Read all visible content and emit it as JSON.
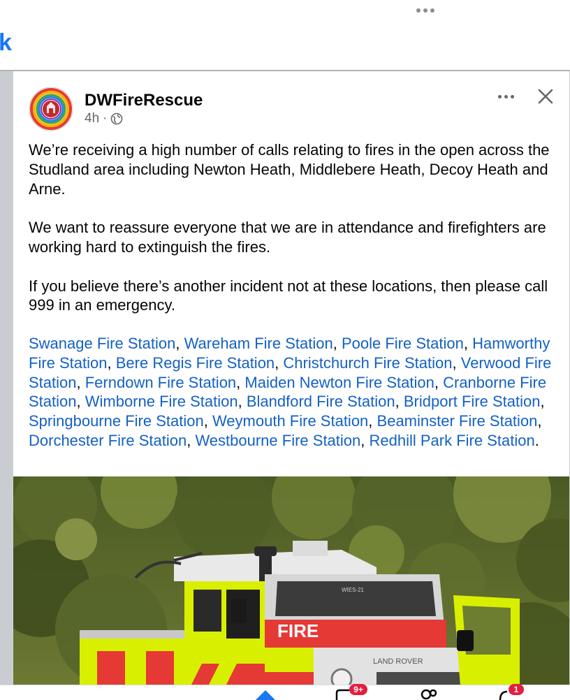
{
  "topbar": {
    "back_glyph": "k"
  },
  "post": {
    "author": "DWFireRescue",
    "time": "4h",
    "separator": "·",
    "paragraphs": [
      "We’re receiving a high number of calls relating to fires in the open across the Studland area including Newton Heath, Middlebere Heath, Decoy Heath and Arne.",
      "We want to reassure everyone that we are in attendance and firefighters are working hard to extinguish the fires.",
      "If you believe there’s another incident not at these locations, then please call 999 in an emergency."
    ],
    "tags": [
      "Swanage Fire Station",
      "Wareham Fire Station",
      "Poole Fire Station",
      "Hamworthy Fire Station",
      "Bere Regis Fire Station",
      "Christchurch Fire Station",
      "Verwood Fire Station",
      "Ferndown Fire Station",
      "Maiden Newton Fire Station",
      "Cranborne Fire Station",
      "Wimborne Fire Station",
      "Blandford Fire Station",
      "Bridport Fire Station",
      "Springbourne Fire Station",
      "Weymouth Fire Station",
      "Beaminster Fire Station",
      "Dorchester Fire Station",
      "Westbourne Fire Station",
      "Redhill Park Fire Station"
    ],
    "tag_separator": ", ",
    "tag_end": ".",
    "photo_text": {
      "door": "FIRE",
      "bonnet": "LAND ROVER",
      "windscreen": "WIES-21"
    }
  },
  "bottom_nav": {
    "badges": [
      "9+",
      "1"
    ]
  },
  "colors": {
    "link": "#1461c4",
    "accent": "#1877f2",
    "badge": "#e41e3f",
    "hi_vis_yellow": "#d8f000"
  },
  "icons": [
    "more-dots-icon",
    "close-icon",
    "globe-icon",
    "home-icon",
    "video-icon",
    "friends-icon",
    "notifications-icon"
  ]
}
